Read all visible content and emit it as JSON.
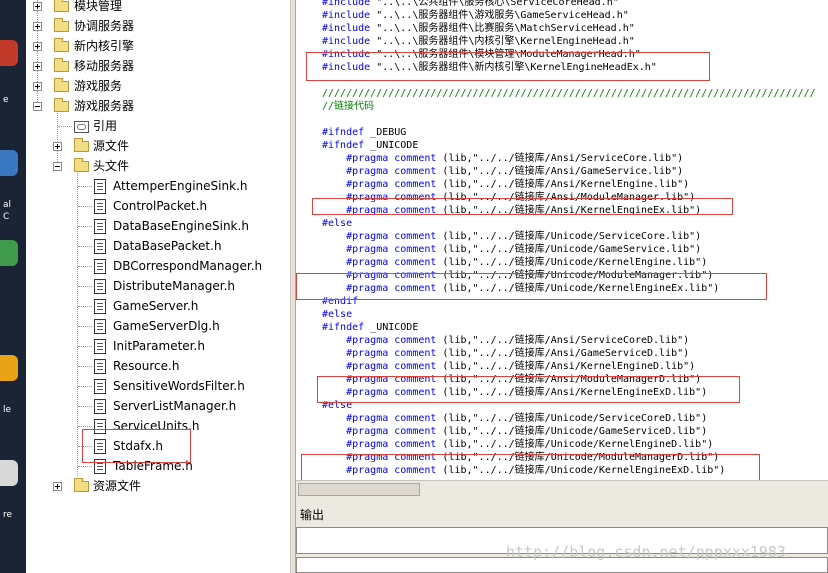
{
  "tree": {
    "top_nodes": [
      {
        "label": "模块管理"
      },
      {
        "label": "协调服务器"
      },
      {
        "label": "新内核引擎"
      },
      {
        "label": "移动服务器"
      },
      {
        "label": "游戏服务"
      },
      {
        "label": "游戏服务器"
      }
    ],
    "children": [
      {
        "label": "引用"
      },
      {
        "label": "源文件"
      },
      {
        "label": "头文件"
      }
    ],
    "header_files": [
      "AttemperEngineSink.h",
      "ControlPacket.h",
      "DataBaseEngineSink.h",
      "DataBasePacket.h",
      "DBCorrespondManager.h",
      "DistributeManager.h",
      "GameServer.h",
      "GameServerDlg.h",
      "InitParameter.h",
      "Resource.h",
      "SensitiveWordsFilter.h",
      "ServerListManager.h",
      "ServiceUnits.h",
      "Stdafx.h",
      "TableFrame.h"
    ],
    "resource_folder": "资源文件"
  },
  "editor": {
    "lines": [
      {
        "kw": "#include",
        "rest": " \"..\\..\\公共组件\\服务核心\\ServiceCoreHead.h\"",
        "indent": ""
      },
      {
        "kw": "#include",
        "rest": " \"..\\..\\服务器组件\\游戏服务\\GameServiceHead.h\"",
        "indent": ""
      },
      {
        "kw": "#include",
        "rest": " \"..\\..\\服务器组件\\比赛服务\\MatchServiceHead.h\"",
        "indent": ""
      },
      {
        "kw": "#include",
        "rest": " \"..\\..\\服务器组件\\内核引擎\\KernelEngineHead.h\"",
        "indent": ""
      },
      {
        "kw": "#include",
        "rest": " \"..\\..\\服务器组件\\模块管理\\ModuleManagerHead.h\"",
        "indent": ""
      },
      {
        "kw": "#include",
        "rest": " \"..\\..\\服务器组件\\新内核引擎\\KernelEngineHeadEx.h\"",
        "indent": ""
      },
      {
        "kw": "",
        "rest": "",
        "indent": ""
      },
      {
        "cm": "//////////////////////////////////////////////////////////////////////////////////",
        "indent": ""
      },
      {
        "cm": "//链接代码",
        "indent": ""
      },
      {
        "kw": "",
        "rest": "",
        "indent": ""
      },
      {
        "kw": "#ifndef",
        "rest": " _DEBUG",
        "indent": ""
      },
      {
        "kw": "#ifndef",
        "rest": " _UNICODE",
        "indent": ""
      },
      {
        "kw": "#pragma comment",
        "rest": " (lib,\"../../链接库/Ansi/ServiceCore.lib\")",
        "indent": "    "
      },
      {
        "kw": "#pragma comment",
        "rest": " (lib,\"../../链接库/Ansi/GameService.lib\")",
        "indent": "    "
      },
      {
        "kw": "#pragma comment",
        "rest": " (lib,\"../../链接库/Ansi/KernelEngine.lib\")",
        "indent": "    "
      },
      {
        "kw": "#pragma comment",
        "rest": " (lib,\"../../链接库/Ansi/ModuleManager.lib\")",
        "indent": "    "
      },
      {
        "kw": "#pragma comment",
        "rest": " (lib,\"../../链接库/Ansi/KernelEngineEx.lib\")",
        "indent": "    "
      },
      {
        "kw": "#else",
        "rest": "",
        "indent": ""
      },
      {
        "kw": "#pragma comment",
        "rest": " (lib,\"../../链接库/Unicode/ServiceCore.lib\")",
        "indent": "    "
      },
      {
        "kw": "#pragma comment",
        "rest": " (lib,\"../../链接库/Unicode/GameService.lib\")",
        "indent": "    "
      },
      {
        "kw": "#pragma comment",
        "rest": " (lib,\"../../链接库/Unicode/KernelEngine.lib\")",
        "indent": "    "
      },
      {
        "kw": "#pragma comment",
        "rest": " (lib,\"../../链接库/Unicode/ModuleManager.lib\")",
        "indent": "    "
      },
      {
        "kw": "#pragma comment",
        "rest": " (lib,\"../../链接库/Unicode/KernelEngineEx.lib\")",
        "indent": "    "
      },
      {
        "kw": "#endif",
        "rest": "",
        "indent": ""
      },
      {
        "kw": "#else",
        "rest": "",
        "indent": ""
      },
      {
        "kw": "#ifndef",
        "rest": " _UNICODE",
        "indent": ""
      },
      {
        "kw": "#pragma comment",
        "rest": " (lib,\"../../链接库/Ansi/ServiceCoreD.lib\")",
        "indent": "    "
      },
      {
        "kw": "#pragma comment",
        "rest": " (lib,\"../../链接库/Ansi/GameServiceD.lib\")",
        "indent": "    "
      },
      {
        "kw": "#pragma comment",
        "rest": " (lib,\"../../链接库/Ansi/KernelEngineD.lib\")",
        "indent": "    "
      },
      {
        "kw": "#pragma comment",
        "rest": " (lib,\"../../链接库/Ansi/ModuleManagerD.lib\")",
        "indent": "    "
      },
      {
        "kw": "#pragma comment",
        "rest": " (lib,\"../../链接库/Ansi/KernelEngineExD.lib\")",
        "indent": "    "
      },
      {
        "kw": "#else",
        "rest": "",
        "indent": ""
      },
      {
        "kw": "#pragma comment",
        "rest": " (lib,\"../../链接库/Unicode/ServiceCoreD.lib\")",
        "indent": "    "
      },
      {
        "kw": "#pragma comment",
        "rest": " (lib,\"../../链接库/Unicode/GameServiceD.lib\")",
        "indent": "    "
      },
      {
        "kw": "#pragma comment",
        "rest": " (lib,\"../../链接库/Unicode/KernelEngineD.lib\")",
        "indent": "    "
      },
      {
        "kw": "#pragma comment",
        "rest": " (lib,\"../../链接库/Unicode/ModuleManagerD.lib\")",
        "indent": "    "
      },
      {
        "kw": "#pragma comment",
        "rest": " (lib,\"../../链接库/Unicode/KernelEngineExD.lib\")",
        "indent": "    "
      }
    ]
  },
  "output": {
    "label": "输出"
  },
  "watermark": "http://blog.csdn.net/pppxxx1983",
  "desktop_strip": {
    "chars": [
      "e",
      "al",
      "C",
      "le",
      "re"
    ]
  },
  "colors": {
    "keyword": "#0000ff",
    "comment": "#008000",
    "highlight_box": "#e0413a"
  }
}
